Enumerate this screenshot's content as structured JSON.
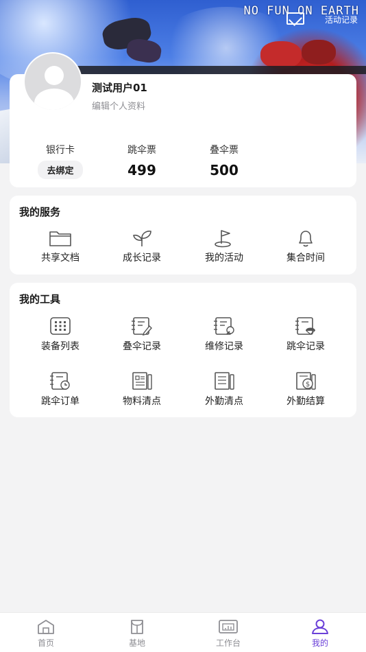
{
  "banner": {
    "headline": "NO FUN ON EARTH",
    "subtext": "活动记录"
  },
  "profile": {
    "username": "测试用户01",
    "edit_link": "编辑个人资料",
    "stats": [
      {
        "label": "银行卡",
        "action": "去绑定"
      },
      {
        "label": "跳伞票",
        "value": "499"
      },
      {
        "label": "叠伞票",
        "value": "500"
      }
    ]
  },
  "services": {
    "title": "我的服务",
    "items": [
      {
        "label": "共享文档",
        "icon": "folder-icon"
      },
      {
        "label": "成长记录",
        "icon": "sprout-icon"
      },
      {
        "label": "我的活动",
        "icon": "flag-icon"
      },
      {
        "label": "集合时间",
        "icon": "bell-icon"
      }
    ]
  },
  "tools": {
    "title": "我的工具",
    "items": [
      {
        "label": "装备列表",
        "icon": "grid-icon"
      },
      {
        "label": "叠伞记录",
        "icon": "notebook-pen-icon"
      },
      {
        "label": "维修记录",
        "icon": "notebook-wrench-icon"
      },
      {
        "label": "跳伞记录",
        "icon": "notebook-parachute-icon"
      },
      {
        "label": "跳伞订单",
        "icon": "notebook-clock-icon"
      },
      {
        "label": "物料清点",
        "icon": "material-list-icon"
      },
      {
        "label": "外勤清点",
        "icon": "fieldwork-list-icon"
      },
      {
        "label": "外勤结算",
        "icon": "settlement-icon"
      }
    ]
  },
  "nav": {
    "items": [
      {
        "label": "首页",
        "icon": "home-icon"
      },
      {
        "label": "基地",
        "icon": "base-icon"
      },
      {
        "label": "工作台",
        "icon": "workbench-icon"
      },
      {
        "label": "我的",
        "icon": "user-icon",
        "active": true
      }
    ]
  },
  "colors": {
    "accent": "#6a3fd8",
    "background": "#f3f3f4",
    "icon_stroke": "#555555"
  }
}
